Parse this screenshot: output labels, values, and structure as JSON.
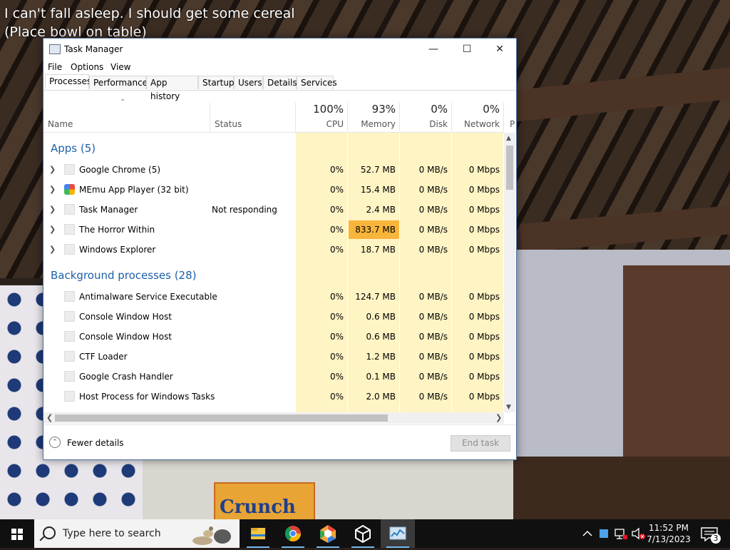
{
  "game": {
    "subtitle_line1": "I can't fall asleep. I should get some cereal",
    "subtitle_line2": "(Place bowl on table)",
    "box_label": "Crunch"
  },
  "window": {
    "title": "Task Manager",
    "menu": [
      "File",
      "Options",
      "View"
    ],
    "tabs": [
      "Processes",
      "Performance",
      "App history",
      "Startup",
      "Users",
      "Details",
      "Services"
    ],
    "active_tab": "Processes"
  },
  "columns": {
    "name": "Name",
    "status": "Status",
    "cpu": {
      "pct": "100%",
      "label": "CPU"
    },
    "memory": {
      "pct": "93%",
      "label": "Memory"
    },
    "disk": {
      "pct": "0%",
      "label": "Disk"
    },
    "network": {
      "pct": "0%",
      "label": "Network"
    },
    "power_partial": "P"
  },
  "groups": {
    "apps": "Apps (5)",
    "background": "Background processes (28)"
  },
  "apps": [
    {
      "name": "Google Chrome (5)",
      "status": "",
      "cpu": "0%",
      "memory": "52.7 MB",
      "disk": "0 MB/s",
      "network": "0 Mbps"
    },
    {
      "name": "MEmu App Player (32 bit)",
      "status": "",
      "cpu": "0%",
      "memory": "15.4 MB",
      "disk": "0 MB/s",
      "network": "0 Mbps"
    },
    {
      "name": "Task Manager",
      "status": "Not responding",
      "cpu": "0%",
      "memory": "2.4 MB",
      "disk": "0 MB/s",
      "network": "0 Mbps"
    },
    {
      "name": "The Horror Within",
      "status": "",
      "cpu": "0%",
      "memory": "833.7 MB",
      "disk": "0 MB/s",
      "network": "0 Mbps"
    },
    {
      "name": "Windows Explorer",
      "status": "",
      "cpu": "0%",
      "memory": "18.7 MB",
      "disk": "0 MB/s",
      "network": "0 Mbps"
    }
  ],
  "background": [
    {
      "name": "Antimalware Service Executable",
      "cpu": "0%",
      "memory": "124.7 MB",
      "disk": "0 MB/s",
      "network": "0 Mbps"
    },
    {
      "name": "Console Window Host",
      "cpu": "0%",
      "memory": "0.6 MB",
      "disk": "0 MB/s",
      "network": "0 Mbps"
    },
    {
      "name": "Console Window Host",
      "cpu": "0%",
      "memory": "0.6 MB",
      "disk": "0 MB/s",
      "network": "0 Mbps"
    },
    {
      "name": "CTF Loader",
      "cpu": "0%",
      "memory": "1.2 MB",
      "disk": "0 MB/s",
      "network": "0 Mbps"
    },
    {
      "name": "Google Crash Handler",
      "cpu": "0%",
      "memory": "0.1 MB",
      "disk": "0 MB/s",
      "network": "0 Mbps"
    },
    {
      "name": "Host Process for Windows Tasks",
      "cpu": "0%",
      "memory": "2.0 MB",
      "disk": "0 MB/s",
      "network": "0 Mbps"
    }
  ],
  "footer": {
    "fewer_details": "Fewer details",
    "end_task": "End task"
  },
  "taskbar": {
    "search_placeholder": "Type here to search",
    "icons": [
      "file-explorer-icon",
      "chrome-icon",
      "memu-icon",
      "unity-icon",
      "task-manager-icon"
    ],
    "time": "11:52 PM",
    "date": "7/13/2023",
    "notification_count": "3"
  },
  "colors": {
    "memory_highlight": "#f8b53b",
    "usage_band": "#fff4c4",
    "group_header": "#1e5fa8"
  }
}
